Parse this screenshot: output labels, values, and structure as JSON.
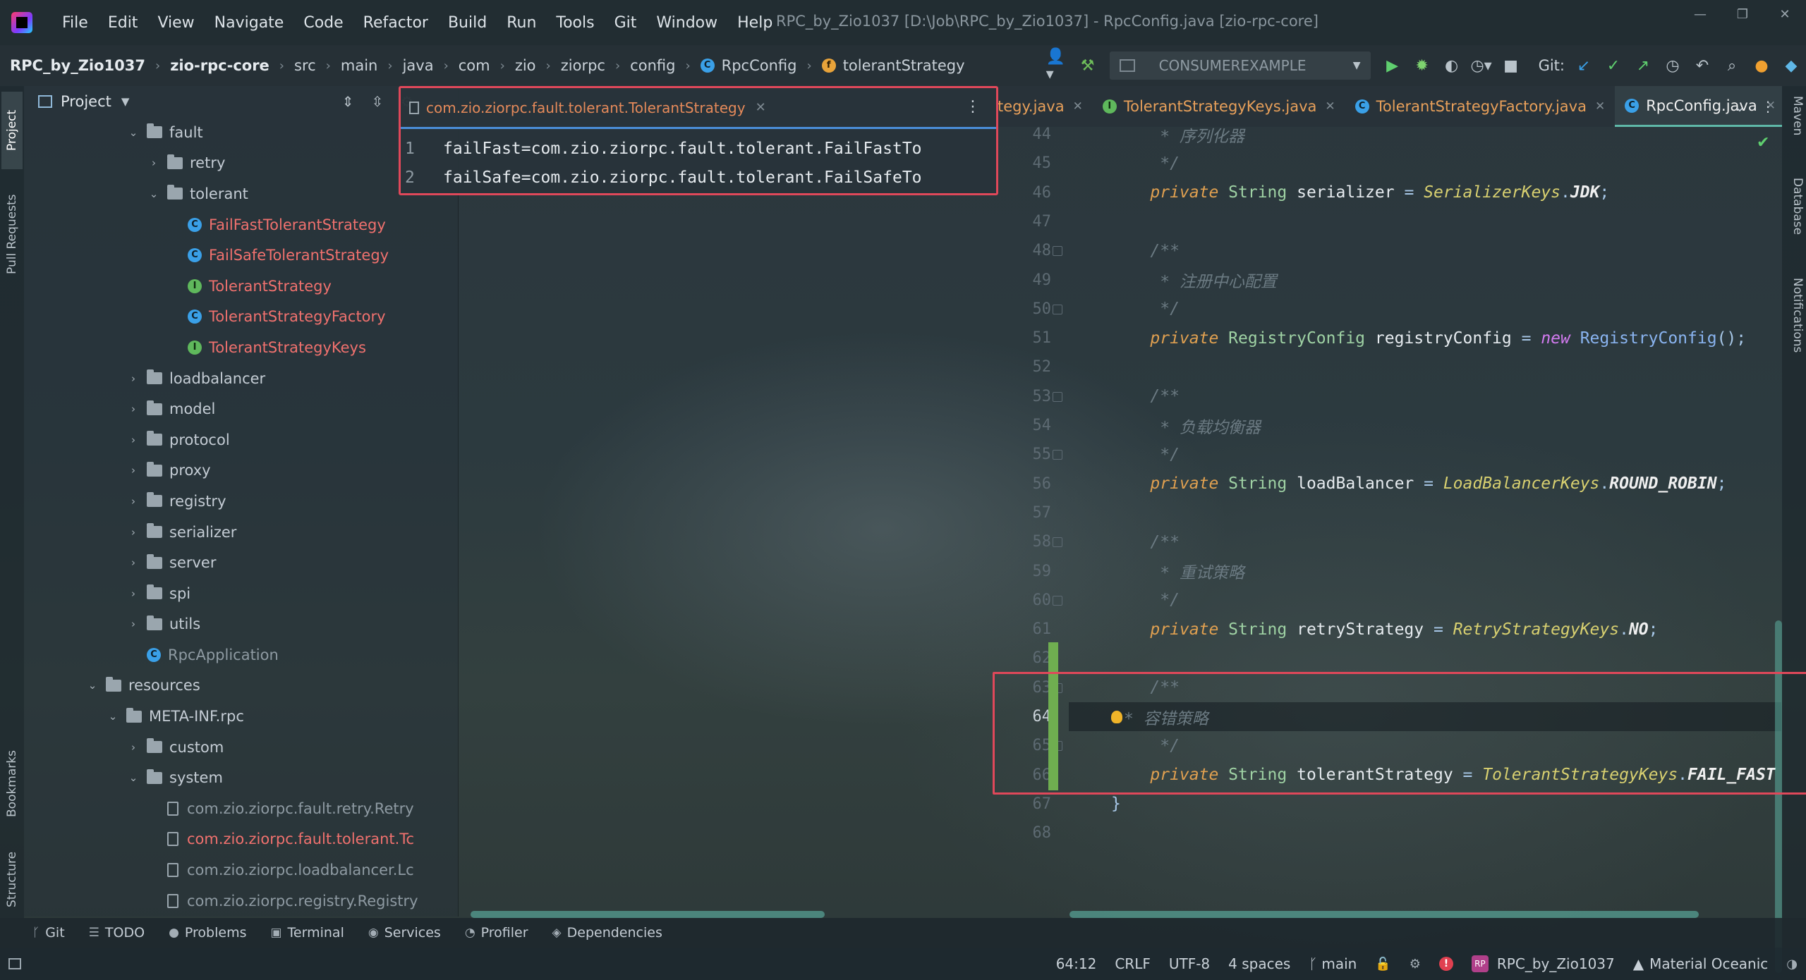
{
  "window": {
    "title": "RPC_by_Zio1037 [D:\\Job\\RPC_by_Zio1037] - RpcConfig.java [zio-rpc-core]"
  },
  "menu": [
    "File",
    "Edit",
    "View",
    "Navigate",
    "Code",
    "Refactor",
    "Build",
    "Run",
    "Tools",
    "Git",
    "Window",
    "Help"
  ],
  "breadcrumbs": [
    "RPC_by_Zio1037",
    "zio-rpc-core",
    "src",
    "main",
    "java",
    "com",
    "zio",
    "ziorpc",
    "config",
    "RpcConfig",
    "tolerantStrategy"
  ],
  "toolbar": {
    "run_config": "CONSUMEREXAMPLE",
    "git_label": "Git:"
  },
  "left_strip": [
    "Project",
    "Pull Requests",
    "Bookmarks",
    "Structure"
  ],
  "right_strip": [
    "Maven",
    "Database",
    "Notifications"
  ],
  "project_panel": {
    "title": "Project",
    "tree": [
      {
        "label": "fault",
        "kind": "folder",
        "depth": 1,
        "open": true,
        "color": "plain"
      },
      {
        "label": "retry",
        "kind": "folder",
        "depth": 2,
        "open": false,
        "color": "plain"
      },
      {
        "label": "tolerant",
        "kind": "folder",
        "depth": 2,
        "open": true,
        "color": "plain"
      },
      {
        "label": "FailFastTolerantStrategy",
        "kind": "class",
        "depth": 3,
        "color": "red"
      },
      {
        "label": "FailSafeTolerantStrategy",
        "kind": "class",
        "depth": 3,
        "color": "red"
      },
      {
        "label": "TolerantStrategy",
        "kind": "interface",
        "depth": 3,
        "color": "red"
      },
      {
        "label": "TolerantStrategyFactory",
        "kind": "class",
        "depth": 3,
        "color": "red"
      },
      {
        "label": "TolerantStrategyKeys",
        "kind": "interface",
        "depth": 3,
        "color": "red"
      },
      {
        "label": "loadbalancer",
        "kind": "folder",
        "depth": 1,
        "open": false,
        "color": "plain"
      },
      {
        "label": "model",
        "kind": "folder",
        "depth": 1,
        "open": false,
        "color": "plain"
      },
      {
        "label": "protocol",
        "kind": "folder",
        "depth": 1,
        "open": false,
        "color": "plain"
      },
      {
        "label": "proxy",
        "kind": "folder",
        "depth": 1,
        "open": false,
        "color": "plain"
      },
      {
        "label": "registry",
        "kind": "folder",
        "depth": 1,
        "open": false,
        "color": "plain"
      },
      {
        "label": "serializer",
        "kind": "folder",
        "depth": 1,
        "open": false,
        "color": "plain"
      },
      {
        "label": "server",
        "kind": "folder",
        "depth": 1,
        "open": false,
        "color": "plain"
      },
      {
        "label": "spi",
        "kind": "folder",
        "depth": 1,
        "open": false,
        "color": "plain"
      },
      {
        "label": "utils",
        "kind": "folder",
        "depth": 1,
        "open": false,
        "color": "plain"
      },
      {
        "label": "RpcApplication",
        "kind": "class",
        "depth": 1,
        "color": "dim"
      },
      {
        "label": "resources",
        "kind": "folder",
        "depth": -1,
        "open": true,
        "color": "plain"
      },
      {
        "label": "META-INF.rpc",
        "kind": "folder",
        "depth": 0,
        "open": true,
        "color": "plain"
      },
      {
        "label": "custom",
        "kind": "folder",
        "depth": 1,
        "open": false,
        "color": "plain"
      },
      {
        "label": "system",
        "kind": "folder",
        "depth": 1,
        "open": true,
        "color": "plain"
      },
      {
        "label": "com.zio.ziorpc.fault.retry.Retry",
        "kind": "file",
        "depth": 2,
        "color": "dim"
      },
      {
        "label": "com.zio.ziorpc.fault.tolerant.Tc",
        "kind": "file",
        "depth": 2,
        "color": "red"
      },
      {
        "label": "com.zio.ziorpc.loadbalancer.Lc",
        "kind": "file",
        "depth": 2,
        "color": "dim"
      },
      {
        "label": "com.zio.ziorpc.registry.Registry",
        "kind": "file",
        "depth": 2,
        "color": "dim"
      }
    ]
  },
  "popup": {
    "title": "com.zio.ziorpc.fault.tolerant.TolerantStrategy",
    "lines": [
      {
        "num": "1",
        "text": "failFast=com.zio.ziorpc.fault.tolerant.FailFastTo"
      },
      {
        "num": "2",
        "text": "failSafe=com.zio.ziorpc.fault.tolerant.FailSafeTo"
      }
    ]
  },
  "editor_tabs": [
    {
      "label": "tegy.java",
      "active": false
    },
    {
      "label": "TolerantStrategyKeys.java",
      "active": false
    },
    {
      "label": "TolerantStrategyFactory.java",
      "active": false
    },
    {
      "label": "RpcConfig.java",
      "active": true
    }
  ],
  "editor": {
    "current_line": "64",
    "lines": [
      {
        "num": "44",
        "tokens": [
          [
            "cmt",
            "     * 序列化器"
          ]
        ]
      },
      {
        "num": "45",
        "tokens": [
          [
            "cmt",
            "     */"
          ]
        ]
      },
      {
        "num": "46",
        "tokens": [
          [
            "kw",
            "    private "
          ],
          [
            "ty",
            "String "
          ],
          [
            "id",
            "serializer "
          ],
          [
            "op",
            "= "
          ],
          [
            "cls",
            "SerializerKeys"
          ],
          [
            "op",
            "."
          ],
          [
            "const",
            "JDK"
          ],
          [
            "op",
            ";"
          ]
        ]
      },
      {
        "num": "47",
        "tokens": []
      },
      {
        "num": "48",
        "tokens": [
          [
            "cmt",
            "    /**"
          ]
        ]
      },
      {
        "num": "49",
        "tokens": [
          [
            "cmt",
            "     * 注册中心配置"
          ]
        ]
      },
      {
        "num": "50",
        "tokens": [
          [
            "cmt",
            "     */"
          ]
        ]
      },
      {
        "num": "51",
        "tokens": [
          [
            "kw",
            "    private "
          ],
          [
            "ty",
            "RegistryConfig "
          ],
          [
            "id",
            "registryConfig "
          ],
          [
            "op",
            "= "
          ],
          [
            "nw",
            "new "
          ],
          [
            "fn",
            "RegistryConfig"
          ],
          [
            "op",
            "();"
          ]
        ]
      },
      {
        "num": "52",
        "tokens": []
      },
      {
        "num": "53",
        "tokens": [
          [
            "cmt",
            "    /**"
          ]
        ]
      },
      {
        "num": "54",
        "tokens": [
          [
            "cmt",
            "     * 负载均衡器"
          ]
        ]
      },
      {
        "num": "55",
        "tokens": [
          [
            "cmt",
            "     */"
          ]
        ]
      },
      {
        "num": "56",
        "tokens": [
          [
            "kw",
            "    private "
          ],
          [
            "ty",
            "String "
          ],
          [
            "id",
            "loadBalancer "
          ],
          [
            "op",
            "= "
          ],
          [
            "cls",
            "LoadBalancerKeys"
          ],
          [
            "op",
            "."
          ],
          [
            "const",
            "ROUND_ROBIN"
          ],
          [
            "op",
            ";"
          ]
        ]
      },
      {
        "num": "57",
        "tokens": []
      },
      {
        "num": "58",
        "tokens": [
          [
            "cmt",
            "    /**"
          ]
        ]
      },
      {
        "num": "59",
        "tokens": [
          [
            "cmt",
            "     * 重试策略"
          ]
        ]
      },
      {
        "num": "60",
        "tokens": [
          [
            "cmt",
            "     */"
          ]
        ]
      },
      {
        "num": "61",
        "tokens": [
          [
            "kw",
            "    private "
          ],
          [
            "ty",
            "String "
          ],
          [
            "id",
            "retryStrategy "
          ],
          [
            "op",
            "= "
          ],
          [
            "cls",
            "RetryStrategyKeys"
          ],
          [
            "op",
            "."
          ],
          [
            "const",
            "NO"
          ],
          [
            "op",
            ";"
          ]
        ]
      },
      {
        "num": "62",
        "tokens": []
      },
      {
        "num": "63",
        "tokens": [
          [
            "cmt",
            "    /**"
          ]
        ]
      },
      {
        "num": "64",
        "tokens": [
          [
            "bulb",
            ""
          ],
          [
            "cmt",
            "* 容错策略"
          ]
        ]
      },
      {
        "num": "65",
        "tokens": [
          [
            "cmt",
            "     */"
          ]
        ]
      },
      {
        "num": "66",
        "tokens": [
          [
            "kw",
            "    private "
          ],
          [
            "ty",
            "String "
          ],
          [
            "id",
            "tolerantStrategy "
          ],
          [
            "op",
            "= "
          ],
          [
            "cls",
            "TolerantStrategyKeys"
          ],
          [
            "op",
            "."
          ],
          [
            "const",
            "FAIL_FAST"
          ]
        ]
      },
      {
        "num": "67",
        "tokens": [
          [
            "op",
            "}"
          ]
        ]
      },
      {
        "num": "68",
        "tokens": []
      }
    ]
  },
  "bottom_tabs": [
    {
      "label": "Git",
      "icon": "ᚴ"
    },
    {
      "label": "TODO",
      "icon": "☰"
    },
    {
      "label": "Problems",
      "icon": "●"
    },
    {
      "label": "Terminal",
      "icon": "▣"
    },
    {
      "label": "Services",
      "icon": "◉"
    },
    {
      "label": "Profiler",
      "icon": "◔"
    },
    {
      "label": "Dependencies",
      "icon": "◈"
    }
  ],
  "status": {
    "position": "64:12",
    "line_ending": "CRLF",
    "encoding": "UTF-8",
    "indent": "4 spaces",
    "branch": "main",
    "project": "RPC_by_Zio1037",
    "theme": "Material Oceanic"
  }
}
